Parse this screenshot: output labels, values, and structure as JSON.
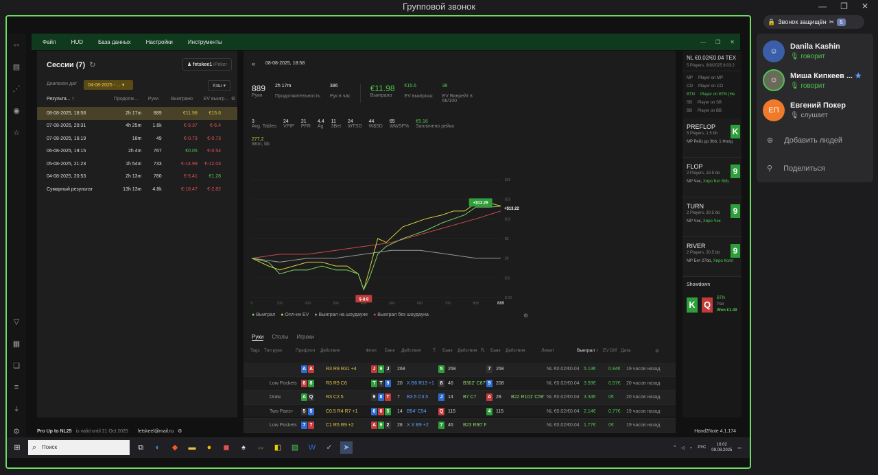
{
  "window": {
    "title": "Групповой звонок"
  },
  "h2n": {
    "menu": [
      "Файл",
      "HUD",
      "База данных",
      "Настройки",
      "Инструменты"
    ],
    "sessions": {
      "title": "Сессии (7)",
      "account": "fetskee1",
      "account_site": "iPoker",
      "range_label": "Диапазон дат",
      "range_value": "04-08-2025 - ...",
      "cache": "Кэш",
      "columns": [
        "Результа...",
        "Продолж...",
        "Руки",
        "Выиграно",
        "EV выигр..."
      ],
      "rows": [
        {
          "date": "08-08-2025, 18:58",
          "dur": "2h 17m",
          "hands": "889",
          "won": "€11.98",
          "ev": "€15.6"
        },
        {
          "date": "07-08-2025, 20:31",
          "dur": "4h 25m",
          "hands": "1.6k",
          "won": "€-9.37",
          "ev": "€-6.4"
        },
        {
          "date": "07-08-2025, 16:19",
          "dur": "18m",
          "hands": "49",
          "won": "€-0.73",
          "ev": "€-0.73"
        },
        {
          "date": "06-08-2025, 19:15",
          "dur": "2h 4m",
          "hands": "767",
          "won": "€0.05",
          "ev": "€-0.54"
        },
        {
          "date": "05-08-2025, 21:23",
          "dur": "1h 54m",
          "hands": "733",
          "won": "€-14.99",
          "ev": "€-12.03"
        },
        {
          "date": "04-08-2025, 20:53",
          "dur": "2h 13m",
          "hands": "780",
          "won": "€-5.41",
          "ev": "€1.28"
        },
        {
          "date": "Сумарный результат",
          "dur": "13h 13m",
          "hands": "4.8k",
          "won": "€-18.47",
          "ev": "€-2.82"
        }
      ]
    },
    "session": {
      "datetime": "08-08-2025, 18:58",
      "hands": "889",
      "hands_lbl": "Руки",
      "duration": "2h 17m",
      "duration_lbl": "Продолжительность",
      "per_hour": "386",
      "per_hour_lbl": "Рук в час",
      "won": "€11.98",
      "won_lbl": "Выиграно",
      "ev": "€15.6",
      "ev_lbl": "EV выигрыш",
      "ev_pct": "38",
      "ev_pct_lbl": "EV Винрейт в 66/100",
      "stats": [
        {
          "v": "3",
          "l": "Avg. Tables"
        },
        {
          "v": "24",
          "l": "VPIP"
        },
        {
          "v": "21",
          "l": "PFR"
        },
        {
          "v": "4.4",
          "l": "Ag"
        },
        {
          "v": "11",
          "l": "3Bet"
        },
        {
          "v": "24",
          "l": "WTSD"
        },
        {
          "v": "44",
          "l": "W$SD"
        },
        {
          "v": "65",
          "l": "WWSF%"
        },
        {
          "v": "€5.16",
          "l": "Заплачено рейка"
        }
      ],
      "won_bb": "277.2",
      "won_bb_lbl": "Won, bb"
    },
    "chart_data": {
      "type": "line",
      "x_ticks": [
        "0",
        "100",
        "200",
        "300",
        "400",
        "500",
        "600",
        "700",
        "800",
        "889"
      ],
      "y_ticks": [
        "$20",
        "$15",
        "$10",
        "$5",
        "$0",
        "$-5",
        "$-10"
      ],
      "ylim": [
        -10,
        20
      ],
      "xlim": [
        0,
        889
      ],
      "annotations": [
        "+$13.29",
        "+$13.22",
        "$-8.9"
      ],
      "series": [
        {
          "name": "Выиграл",
          "color": "#7ad26b",
          "x": [
            0,
            60,
            100,
            150,
            200,
            250,
            300,
            340,
            380,
            400,
            420,
            450,
            480,
            510,
            540,
            580,
            620,
            680,
            720,
            760,
            800,
            850,
            889
          ],
          "y": [
            0,
            -1,
            -4,
            -3,
            -3,
            -2,
            -3,
            -3,
            -4,
            -8,
            -5,
            1,
            3,
            4,
            5,
            6,
            7,
            9,
            10,
            11,
            13,
            13,
            13.22
          ]
        },
        {
          "name": "Олл-ин EV",
          "color": "#d8d042",
          "x": [
            0,
            60,
            100,
            150,
            200,
            250,
            300,
            340,
            380,
            400,
            420,
            450,
            480,
            510,
            540,
            580,
            620,
            680,
            720,
            760,
            800,
            850,
            889
          ],
          "y": [
            0,
            -2,
            -3,
            -2,
            -1,
            -1,
            -2,
            -2,
            -4,
            -8,
            -3,
            5,
            4,
            6,
            8,
            9,
            10,
            11,
            12,
            12,
            14,
            14,
            13.29
          ]
        },
        {
          "name": "Выиграл на шоудауне",
          "color": "#9a9a9a",
          "x": [
            0,
            100,
            200,
            300,
            400,
            500,
            600,
            700,
            800,
            889
          ],
          "y": [
            0,
            -1,
            0,
            0,
            1,
            2,
            2,
            1,
            0,
            0
          ]
        },
        {
          "name": "Выиграл без шоудауна",
          "color": "#d04a4a",
          "x": [
            0,
            100,
            200,
            300,
            400,
            500,
            600,
            700,
            800,
            889
          ],
          "y": [
            0,
            1,
            1,
            2,
            3,
            4,
            6,
            8,
            10,
            12
          ]
        }
      ]
    },
    "legend": [
      "Выиграл",
      "Олл-ин EV",
      "Выиграл на шоудауне",
      "Выиграл без шоудауна"
    ],
    "tabs": [
      "Руки",
      "Столы",
      "Игроки"
    ],
    "hand_cols": [
      "Tags",
      "Тип руки",
      "Префлоп",
      "Действия",
      "Флоп",
      "Банк",
      "Действия",
      "T.",
      "Банк",
      "Действия",
      "R.",
      "Банк",
      "Действия",
      "Лимит",
      "Выиграл",
      "EV Diff",
      "Дата"
    ],
    "hands": [
      {
        "type": "",
        "pre": [
          "A",
          "A"
        ],
        "pa": "R3 R9 R31 +4",
        "flop": [
          "J",
          "9",
          "J"
        ],
        "fb": "268",
        "fa": "",
        "turn": "5",
        "tb": "268",
        "ta": "",
        "river": "7",
        "rb": "268",
        "ra": "",
        "limit": "NL €0.02/€0.04",
        "won": "5.13€",
        "ev": "0.84€",
        "date": "19 часов назад"
      },
      {
        "type": "Low Pockets",
        "pre": [
          "8",
          "8"
        ],
        "pa": "R3 R9 C6",
        "flop": [
          "T",
          "T",
          "9"
        ],
        "fb": "20",
        "fa": "X B6 R13 +1",
        "turn": "8",
        "tb": "46",
        "ta": "B302' C87'",
        "river": "9",
        "rb": "208",
        "ra": "",
        "limit": "NL €0.02/€0.04",
        "won": "3.93€",
        "ev": "0.57€",
        "date": "20 часов назад"
      },
      {
        "type": "Draw",
        "pre": [
          "A",
          "Q"
        ],
        "pa": "R3 C2.5",
        "flop": [
          "9",
          "8",
          "T"
        ],
        "fb": "7",
        "fa": "B3.5 C3.5",
        "turn": "J",
        "tb": "14",
        "ta": "B7 C7",
        "river": "A",
        "rb": "28",
        "ra": "B22 R101' C59'",
        "limit": "NL €0.02/€0.04",
        "won": "3.34€",
        "ev": "0€",
        "date": "20 часов назад"
      },
      {
        "type": "Two Pairs+",
        "pre": [
          "5",
          "5"
        ],
        "pa": "C0.5 R4 R7 +1",
        "flop": [
          "6",
          "6",
          "5"
        ],
        "fb": "14",
        "fa": "B54' C54",
        "turn": "Q",
        "tb": "115",
        "ta": "",
        "river": "4",
        "rb": "115",
        "ra": "",
        "limit": "NL €0.02/€0.04",
        "won": "2.14€",
        "ev": "0.77€",
        "date": "19 часов назад"
      },
      {
        "type": "Low Pockets",
        "pre": [
          "7",
          "7"
        ],
        "pa": "C1 R5 R9 +2",
        "flop": [
          "A",
          "9",
          "2"
        ],
        "fb": "28",
        "fa": "X X B9 +2",
        "turn": "7",
        "tb": "46",
        "ta": "B23 R90' F",
        "river": "",
        "rb": "",
        "ra": "",
        "limit": "NL €0.02/€0.04",
        "won": "1.77€",
        "ev": "0€",
        "date": "19 часов назад"
      }
    ],
    "replay": {
      "title": "NL €0.02/€0.04 TEX",
      "sub": "5 Players, 8/8/2025 8:03:2",
      "seats": [
        {
          "pos": "MP",
          "name": "Player on MP"
        },
        {
          "pos": "CO",
          "name": "Player on CO"
        },
        {
          "pos": "BTN",
          "name": "Player on BTN (He"
        },
        {
          "pos": "SB",
          "name": "Player on SB"
        },
        {
          "pos": "BB",
          "name": "Player on BB"
        }
      ],
      "streets": [
        {
          "name": "PREFLOP",
          "desc": "5 Players, 1.5 bb",
          "act": "MP Рейз до 3bb, 1 Фолд",
          "hl": "",
          "card": "K"
        },
        {
          "name": "FLOP",
          "desc": "2 Players, 19.5 bb",
          "act": "MP Чек,",
          "hl": "Хиро Бет 6bb,",
          "card": "9"
        },
        {
          "name": "TURN",
          "desc": "2 Players, 30.5 bb",
          "act": "MP Чек,",
          "hl": "Хиро Чек",
          "card": "9"
        },
        {
          "name": "RIVER",
          "desc": "2 Players, 30.5 bb",
          "act": "MP Бет 27bb,",
          "hl": "Хиро Колл",
          "card": "9"
        }
      ],
      "showdown": "Showdown",
      "sd_pos": "BTN",
      "sd_hand": "Pair",
      "sd_won": "Won €1.49",
      "sd_cards": [
        "K",
        "Q"
      ]
    },
    "status": {
      "product": "Pro Up to NL25",
      "valid": "is valid until 21 Oct 2025",
      "email": "fetskeel@mail.ru",
      "version": "Hand2Note 4.1.174"
    }
  },
  "taskbar": {
    "search": "Поиск",
    "lang": "РУС",
    "time": "16:02",
    "date": "09.08.2025"
  },
  "call": {
    "security": "Звонок защищён",
    "count": "5",
    "participants": [
      {
        "name": "Danila Kashin",
        "status": "говорит",
        "initials": "",
        "color": "#3a5ea8"
      },
      {
        "name": "Миша Кипкеев ...",
        "status": "говорит",
        "initials": "",
        "color": "#6a6a5a"
      },
      {
        "name": "Евгений Покер",
        "status": "слушает",
        "initials": "ЕП",
        "color": "#f07a2a"
      }
    ],
    "add": "Добавить людей",
    "share": "Поделиться"
  }
}
